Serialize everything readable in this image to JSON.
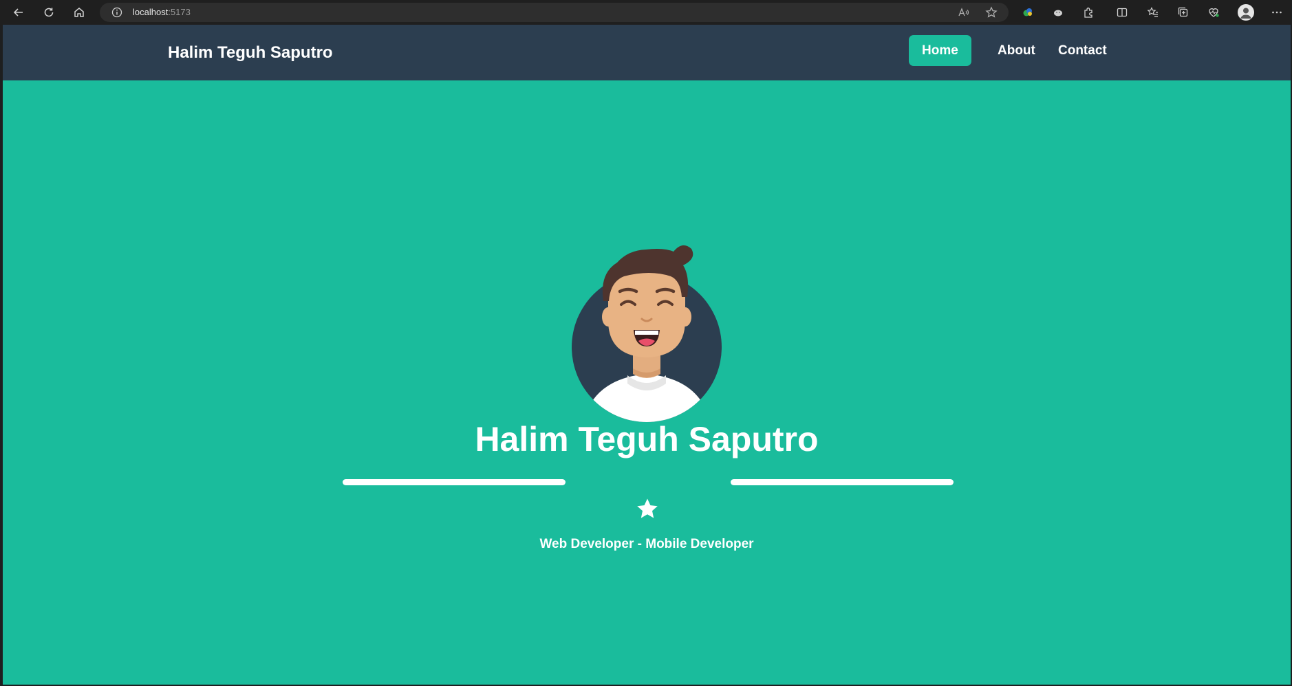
{
  "browser": {
    "url_host": "localhost",
    "url_port": ":5173"
  },
  "navbar": {
    "brand": "Halim Teguh Saputro",
    "links": [
      {
        "label": "Home",
        "active": true
      },
      {
        "label": "About",
        "active": false
      },
      {
        "label": "Contact",
        "active": false
      }
    ]
  },
  "hero": {
    "name": "Halim Teguh Saputro",
    "subtitle": "Web Developer - Mobile Developer"
  },
  "colors": {
    "primary": "#1abc9c",
    "navbar": "#2c3e50",
    "text": "#ffffff"
  }
}
